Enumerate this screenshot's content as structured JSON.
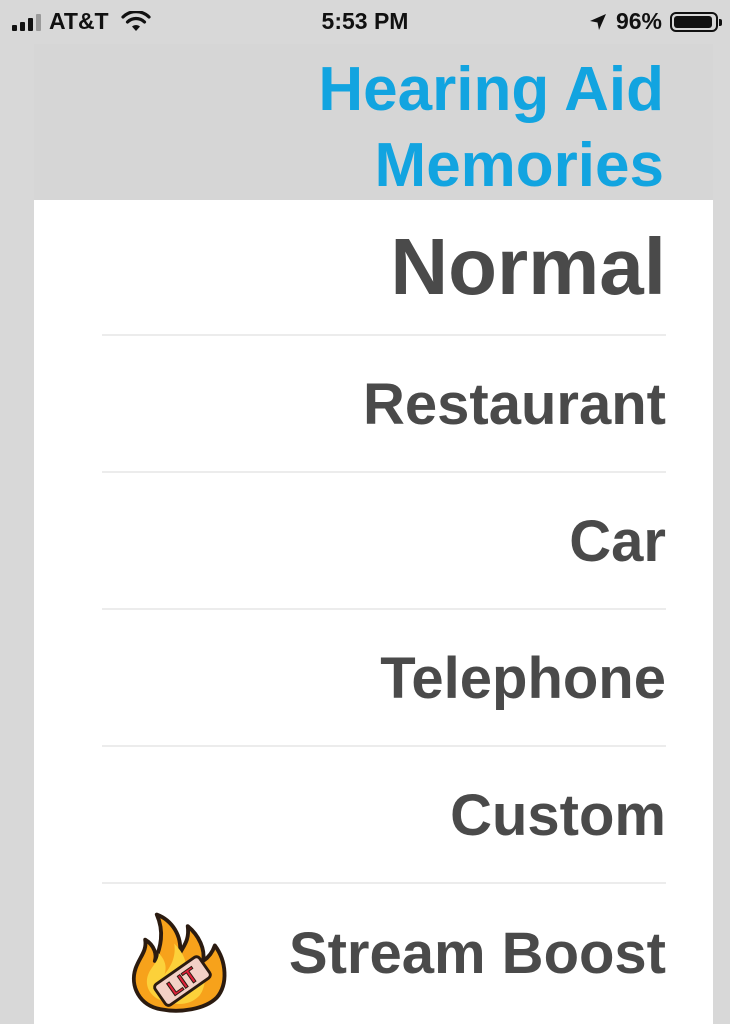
{
  "status_bar": {
    "carrier": "AT&T",
    "time": "5:53 PM",
    "battery_percent": "96%",
    "icons": [
      "signal-icon",
      "wifi-icon",
      "location-arrow-icon",
      "battery-icon"
    ]
  },
  "header": {
    "title": "Hearing Aid Memories",
    "title_color": "#12a4e0"
  },
  "memories": {
    "selected": "Normal",
    "items": [
      {
        "label": "Normal"
      },
      {
        "label": "Restaurant"
      },
      {
        "label": "Car"
      },
      {
        "label": "Telephone"
      },
      {
        "label": "Custom"
      },
      {
        "label": "Stream Boost",
        "sticker": "LIT"
      }
    ]
  }
}
